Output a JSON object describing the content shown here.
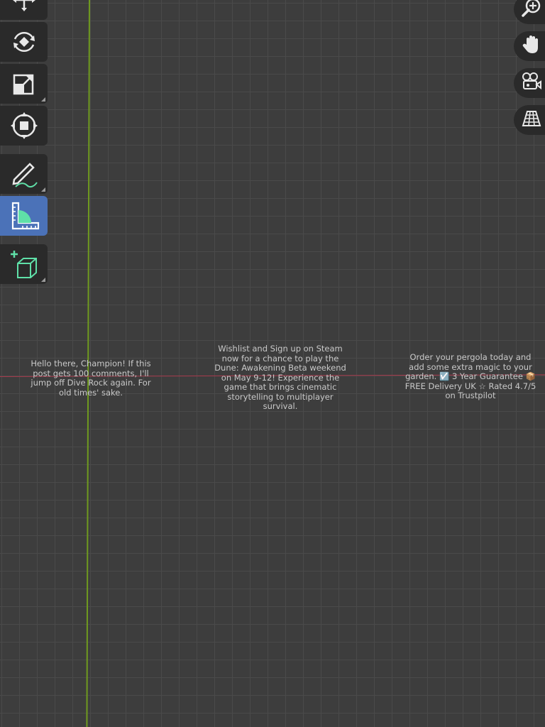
{
  "toolbar": {
    "tools": [
      {
        "name": "move",
        "icon": "move-arrows-icon",
        "active": false
      },
      {
        "name": "rotate",
        "icon": "rotate-icon",
        "active": false
      },
      {
        "name": "scale",
        "icon": "scale-icon",
        "active": false
      },
      {
        "name": "transform",
        "icon": "transform-icon",
        "active": false
      },
      {
        "name": "annotate",
        "icon": "annotate-pencil-icon",
        "active": false
      },
      {
        "name": "measure",
        "icon": "measure-ruler-icon",
        "active": true
      },
      {
        "name": "add-cube",
        "icon": "add-cube-icon",
        "active": false
      }
    ]
  },
  "nav": {
    "buttons": [
      {
        "name": "zoom",
        "icon": "zoom-icon"
      },
      {
        "name": "pan",
        "icon": "hand-pan-icon"
      },
      {
        "name": "camera",
        "icon": "camera-view-icon"
      },
      {
        "name": "perspective",
        "icon": "grid-perspective-icon"
      }
    ]
  },
  "overlay_text": {
    "left": "Hello there, Champion! If this\npost gets 100 comments, I'll\njump off Dive Rock again. For\nold times' sake.",
    "center": "Wishlist and Sign up on Steam\nnow for a chance to play the\nDune: Awakening Beta weekend\non May 9-12! Experience the\ngame that brings cinematic\nstorytelling to multiplayer\nsurvival.",
    "right": "Order your pergola today and\nadd some extra magic to your\ngarden. ☑️ 3 Year Guarantee 📦\nFREE Delivery UK ☆ Rated 4.7/5\non Trustpilot"
  },
  "colors": {
    "background": "#3d3d3d",
    "grid_line": "#4a4a4a",
    "axis_y": "#6f9a1f",
    "axis_x": "#a83a4c",
    "toolbar_bg": "#2a2a2a",
    "active_tool": "#4b72b8",
    "accent_green": "#5fe0a8"
  }
}
